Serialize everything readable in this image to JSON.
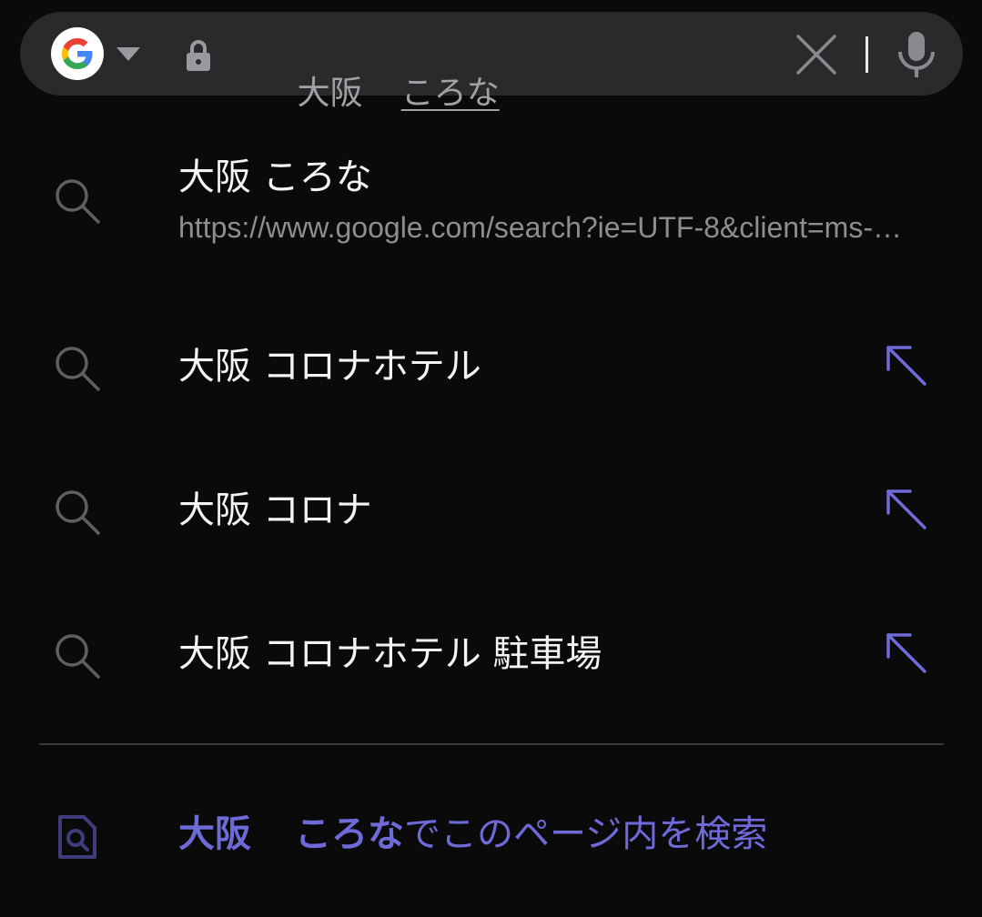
{
  "search_bar": {
    "engine": "google-icon",
    "query_main": "大阪",
    "query_composing": "ころな"
  },
  "suggestions": [
    {
      "title": "大阪 ころな",
      "url": "https://www.google.com/search?ie=UTF-8&client=ms-android-samsung",
      "icon": "search-icon",
      "has_arrow": false
    },
    {
      "title": "大阪 コロナホテル",
      "icon": "search-icon",
      "has_arrow": true
    },
    {
      "title": "大阪 コロナ",
      "icon": "search-icon",
      "has_arrow": true
    },
    {
      "title": "大阪 コロナホテル 駐車場",
      "icon": "search-icon",
      "has_arrow": true
    }
  ],
  "find_in_page": {
    "icon": "find-in-page-icon",
    "query_word1": "大阪",
    "query_word2": "ころな",
    "suffix": "でこのページ内を検索"
  },
  "colors": {
    "background": "#0a0a0b",
    "search_bar": "#2a2a2c",
    "accent": "#6e6ad8",
    "suggestion_text": "#f4f4f6",
    "url_text": "#8d8d92"
  }
}
